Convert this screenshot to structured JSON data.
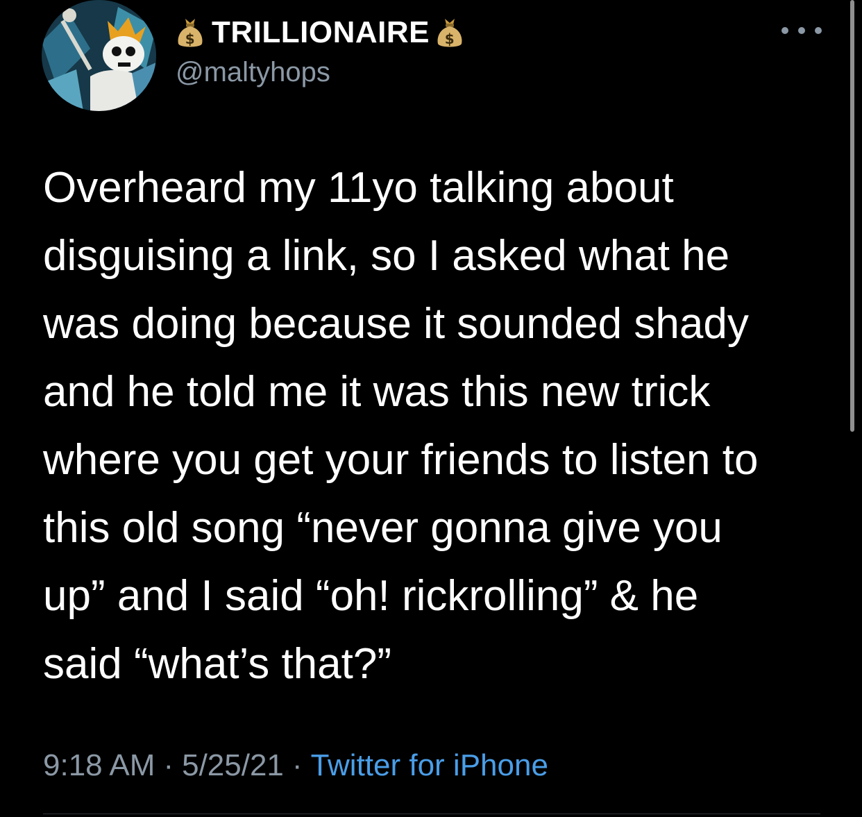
{
  "author": {
    "display_name": "TRILLIONAIRE",
    "handle": "@maltyhops",
    "name_emoji_left": "money-bag-icon",
    "name_emoji_right": "money-bag-icon"
  },
  "tweet": {
    "text": "Overheard my 11yo talking about\ndisguising a link, so I asked what he\nwas doing because it sounded shady\nand he told me it was this new trick\nwhere you get your friends to listen to\nthis old song “never gonna give you\nup” and I said “oh! rickrolling” & he\nsaid “what’s that?”"
  },
  "meta": {
    "time": "9:18 AM",
    "date": "5/25/21",
    "separator": "·",
    "source": "Twitter for iPhone"
  },
  "colors": {
    "background": "#000000",
    "text": "#ffffff",
    "secondary": "#8b98a5",
    "link": "#4a9ee8"
  }
}
